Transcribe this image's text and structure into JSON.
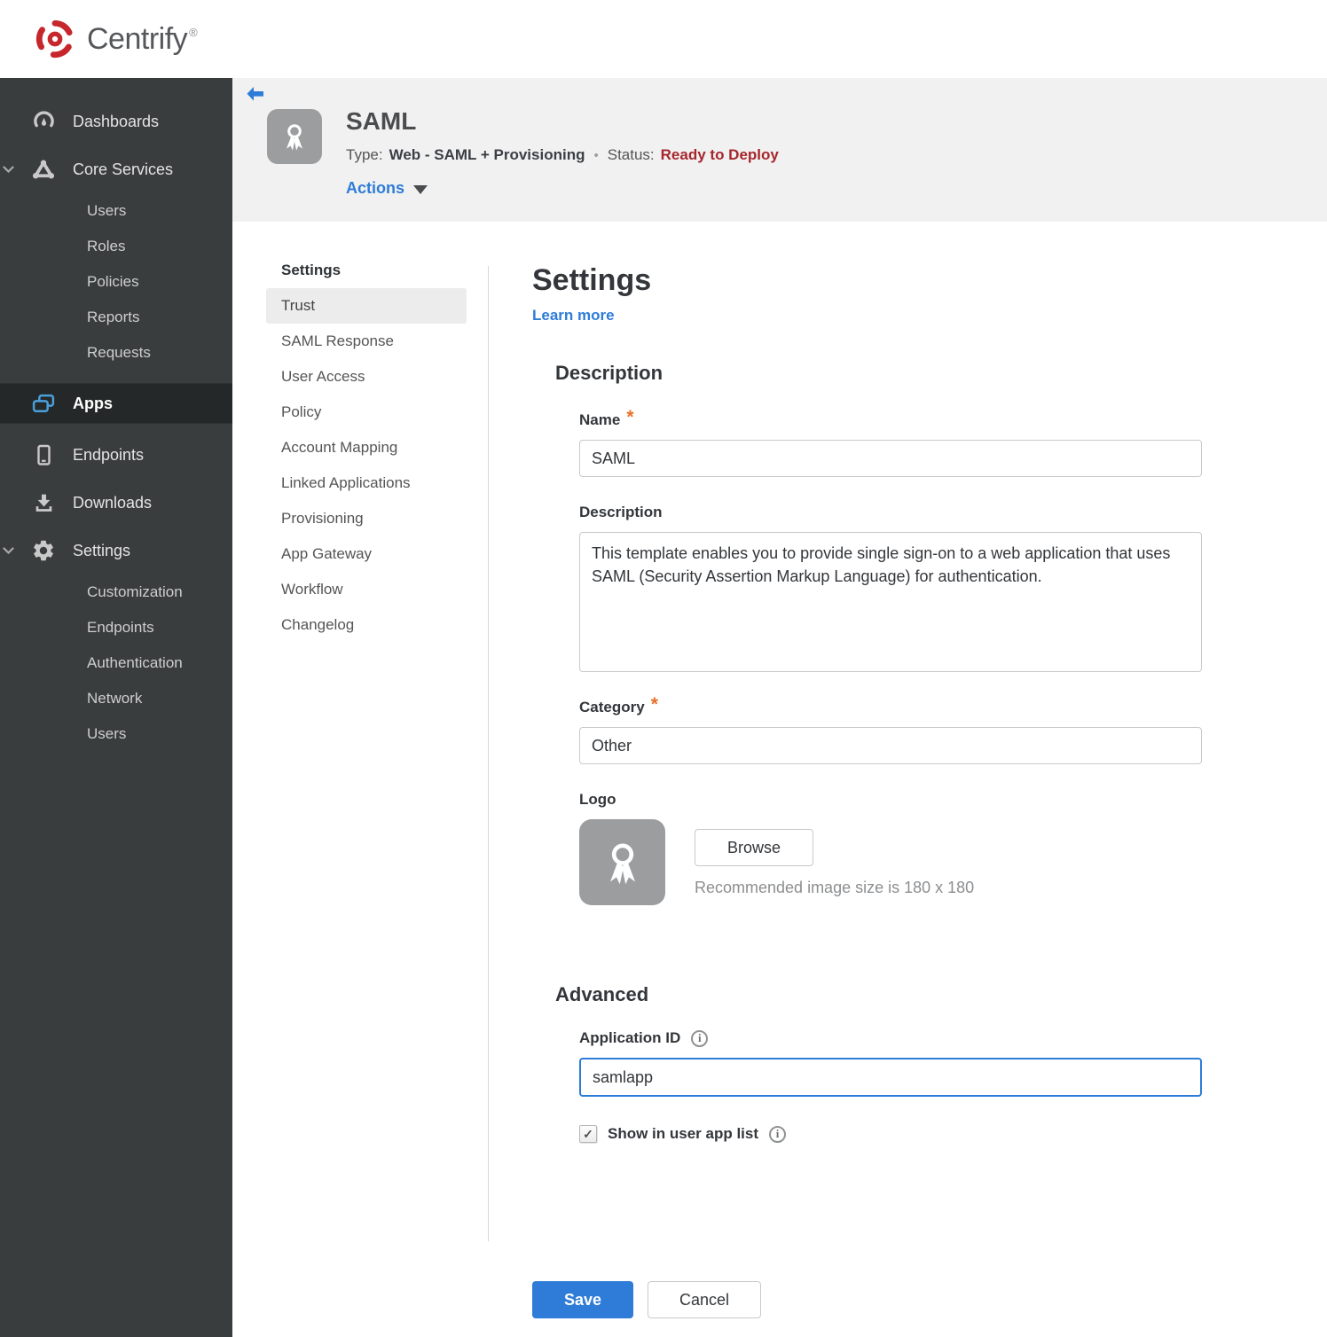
{
  "brand": {
    "name": "Centrify",
    "registered": "®"
  },
  "sidebar": {
    "items": [
      {
        "label": "Dashboards",
        "icon": "gauge-icon"
      },
      {
        "label": "Core Services",
        "icon": "core-services-icon",
        "expanded": true,
        "children": [
          "Users",
          "Roles",
          "Policies",
          "Reports",
          "Requests"
        ]
      },
      {
        "label": "Apps",
        "icon": "apps-icon",
        "active": true
      },
      {
        "label": "Endpoints",
        "icon": "mobile-icon"
      },
      {
        "label": "Downloads",
        "icon": "download-icon"
      },
      {
        "label": "Settings",
        "icon": "gear-icon",
        "expanded": true,
        "children": [
          "Customization",
          "Endpoints",
          "Authentication",
          "Network",
          "Users"
        ]
      }
    ]
  },
  "header": {
    "app_title": "SAML",
    "type_label": "Type:",
    "type_value": "Web - SAML + Provisioning",
    "status_label": "Status:",
    "status_value": "Ready to Deploy",
    "actions_label": "Actions"
  },
  "subnav": {
    "title": "Settings",
    "active_item": "Trust",
    "items": [
      "Trust",
      "SAML Response",
      "User Access",
      "Policy",
      "Account Mapping",
      "Linked Applications",
      "Provisioning",
      "App Gateway",
      "Workflow",
      "Changelog"
    ]
  },
  "main": {
    "page_title": "Settings",
    "learn_more": "Learn more",
    "description": {
      "heading": "Description",
      "name_label": "Name",
      "name_value": "SAML",
      "description_label": "Description",
      "description_value": "This template enables you to provide single sign-on to a web application that uses SAML (Security Assertion Markup Language) for authentication.",
      "category_label": "Category",
      "category_value": "Other",
      "logo_label": "Logo",
      "browse_label": "Browse",
      "recommended": "Recommended image size is 180 x 180"
    },
    "advanced": {
      "heading": "Advanced",
      "app_id_label": "Application ID",
      "app_id_value": "samlapp",
      "show_label": "Show in user app list",
      "checkbox_checked": true
    },
    "buttons": {
      "save": "Save",
      "cancel": "Cancel"
    }
  },
  "icons": {
    "dot": "•",
    "asterisk": "*",
    "info": "i",
    "checkmark": "✓",
    "back": "left-arrow",
    "ribbon": "award-ribbon",
    "caret": "triangle-down"
  },
  "colors": {
    "accent_blue": "#2e7cd8",
    "status_red": "#a6262c",
    "required_orange": "#e8702a",
    "sidebar_bg": "#3a3d3d",
    "sidebar_active_bg": "#252828",
    "header_band": "#f1f1f2",
    "tile_gray": "#9c9d9e",
    "logo_red": "#c5272d"
  }
}
